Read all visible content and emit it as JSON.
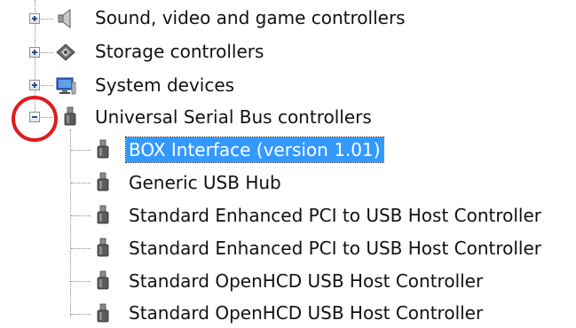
{
  "tree": {
    "categories": [
      {
        "label": "Sound, video and game controllers",
        "icon": "speaker-icon",
        "expanded": false
      },
      {
        "label": "Storage controllers",
        "icon": "storage-controller-icon",
        "expanded": false
      },
      {
        "label": "System devices",
        "icon": "system-devices-icon",
        "expanded": false
      },
      {
        "label": "Universal Serial Bus controllers",
        "icon": "usb-plug-icon",
        "expanded": true
      }
    ],
    "usb_children": [
      {
        "label": "BOX Interface (version 1.01)",
        "icon": "usb-plug-icon",
        "selected": true
      },
      {
        "label": "Generic USB Hub",
        "icon": "usb-plug-icon",
        "selected": false
      },
      {
        "label": "Standard Enhanced PCI to USB Host Controller",
        "icon": "usb-plug-icon",
        "selected": false
      },
      {
        "label": "Standard Enhanced PCI to USB Host Controller",
        "icon": "usb-plug-icon",
        "selected": false
      },
      {
        "label": "Standard OpenHCD USB Host Controller",
        "icon": "usb-plug-icon",
        "selected": false
      },
      {
        "label": "Standard OpenHCD USB Host Controller",
        "icon": "usb-plug-icon",
        "selected": false
      }
    ]
  },
  "annotation": {
    "circle_color": "#e11b1b"
  },
  "colors": {
    "selection": "#3399ff",
    "selection_text": "#ffffff"
  }
}
